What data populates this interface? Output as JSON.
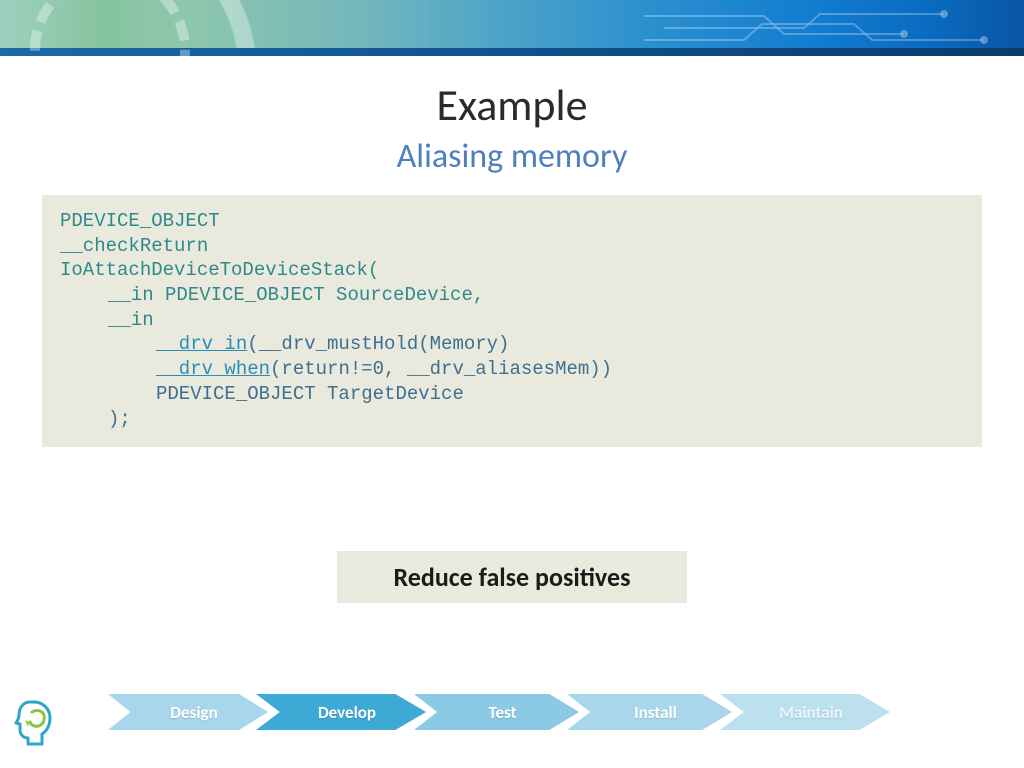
{
  "title": "Example",
  "subtitle": "Aliasing memory",
  "code": {
    "l1": "PDEVICE_OBJECT",
    "l2": "__checkReturn",
    "l3": "IoAttachDeviceToDeviceStack(",
    "l4": "__in PDEVICE_OBJECT SourceDevice,",
    "l5": "__in",
    "l6a": "__drv_in",
    "l6b": "(__drv_mustHold(Memory)",
    "l7a": "__drv_when",
    "l7b": "(return!=0, __drv_aliasesMem))",
    "l8": "PDEVICE_OBJECT TargetDevice",
    "l9": ");"
  },
  "highlight": "Reduce false positives",
  "flow": {
    "steps": [
      "Design",
      "Develop",
      "Test",
      "Install",
      "Maintain"
    ],
    "active_index": 1
  },
  "colors": {
    "subtitle": "#4f7fbf",
    "code_bg": "#e9eadd",
    "arrow_active": "#3fa9d6",
    "arrow_inactive": "#a9d6ea"
  }
}
